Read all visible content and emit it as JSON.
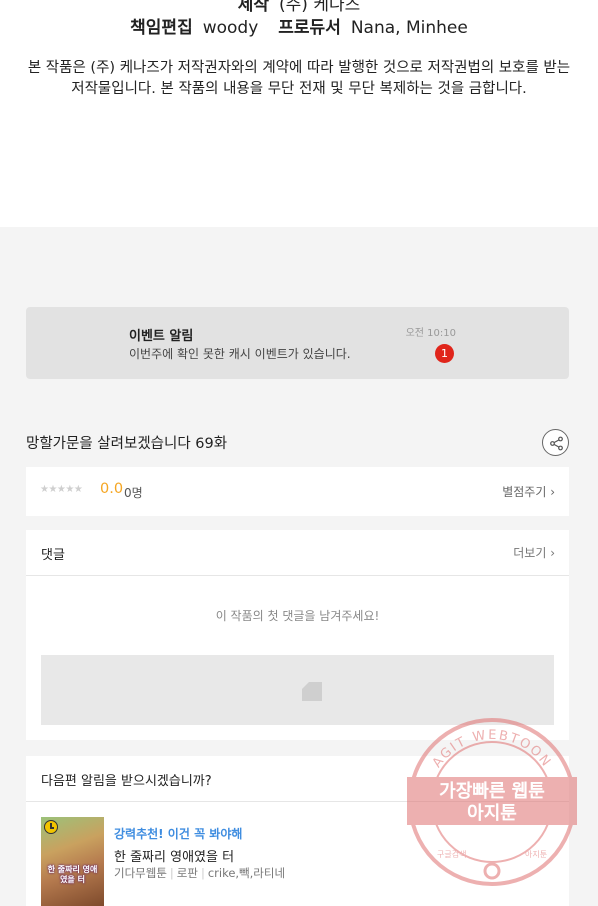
{
  "credits": {
    "line1_label": "제작",
    "line1_value": "(주) 케나즈",
    "editor_label": "책임편집",
    "editor_value": "woody",
    "producer_label": "프로듀서",
    "producer_value": "Nana, Minhee",
    "copyright": "본 작품은 (주) 케나즈가 저작권자와의 계약에 따라 발행한 것으로 저작권법의 보호를 받는 저작물입니다. 본 작품의 내용을 무단 전재 및 무단 복제하는 것을 금합니다."
  },
  "notice": {
    "title": "이벤트 알림",
    "description": "이번주에 확인 못한 캐시 이벤트가 있습니다.",
    "time": "오전 10:10",
    "badge": "1"
  },
  "episode": {
    "title": "망할가문을 살려보겠습니다 69화"
  },
  "rating": {
    "stars": "★★★★★",
    "score": "0.0",
    "count": "0명",
    "rate_link": "별점주기 ›"
  },
  "comments": {
    "title": "댓글",
    "more": "더보기 ›",
    "empty_message": "이 작품의 첫 댓글을 남겨주세요!"
  },
  "next_episode": {
    "question": "다음편 알림을 받으시겠습니까?",
    "recommend_tag": "강력추천! 이건 꼭 봐야해",
    "recommend_title": "한 줄짜리 영애였을 터",
    "category": "기다무웹툰",
    "genre": "로판",
    "authors": "crike,빽,라티네",
    "thumb_title": "한 줄짜리 영애였을 터"
  },
  "watermark": {
    "ring_text": "AGIT WEBTOON",
    "line1": "가장빠른 웹툰",
    "line2": "아지툰",
    "bottom_left": "구글검색",
    "bottom_right": "아지툰"
  },
  "colors": {
    "accent_blue": "#3f8de0",
    "score_orange": "#f5a623",
    "badge_red": "#e0251b",
    "watermark_red": "#e07070"
  }
}
